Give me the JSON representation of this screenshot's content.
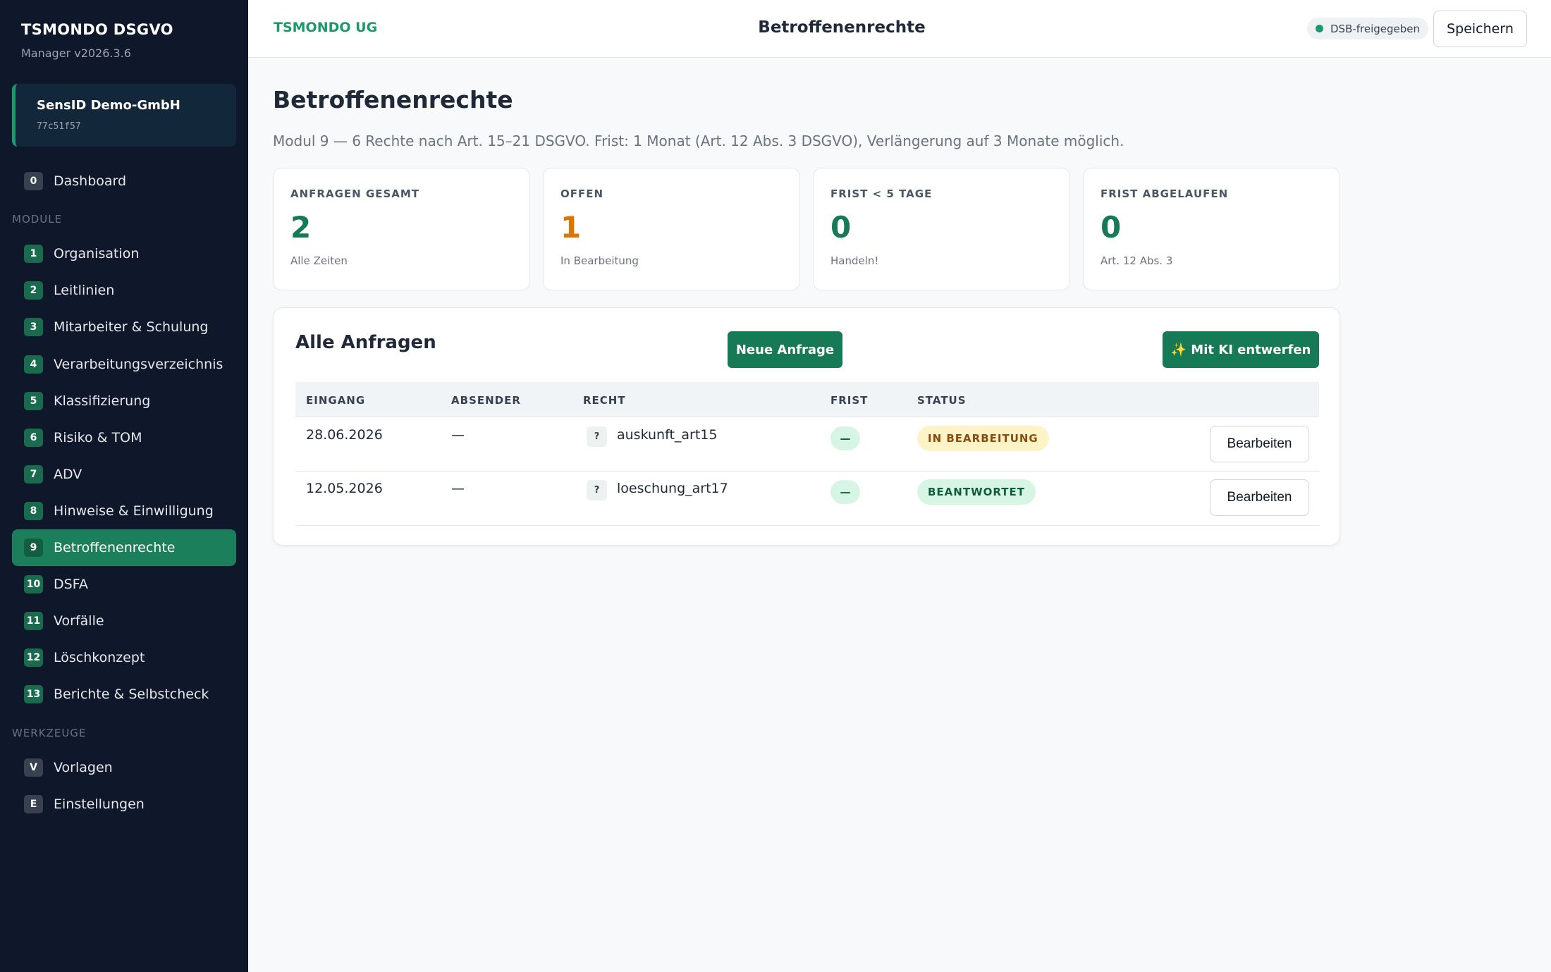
{
  "sidebar": {
    "brand_title": "TSMONDO DSGVO",
    "brand_version": "Manager v2026.3.6",
    "tenant": {
      "name": "SensID Demo-GmbH",
      "id": "77c51f57"
    },
    "dashboard": {
      "badge": "0",
      "label": "Dashboard"
    },
    "modules_label": "MODULE",
    "modules": [
      {
        "badge": "1",
        "label": "Organisation"
      },
      {
        "badge": "2",
        "label": "Leitlinien"
      },
      {
        "badge": "3",
        "label": "Mitarbeiter & Schulung"
      },
      {
        "badge": "4",
        "label": "Verarbeitungsverzeichnis"
      },
      {
        "badge": "5",
        "label": "Klassifizierung"
      },
      {
        "badge": "6",
        "label": "Risiko & TOM"
      },
      {
        "badge": "7",
        "label": "ADV"
      },
      {
        "badge": "8",
        "label": "Hinweise & Einwilligung"
      },
      {
        "badge": "9",
        "label": "Betroffenenrechte"
      },
      {
        "badge": "10",
        "label": "DSFA"
      },
      {
        "badge": "11",
        "label": "Vorfälle"
      },
      {
        "badge": "12",
        "label": "Löschkonzept"
      },
      {
        "badge": "13",
        "label": "Berichte & Selbstcheck"
      }
    ],
    "tools_label": "WERKZEUGE",
    "tools": [
      {
        "badge": "V",
        "label": "Vorlagen"
      },
      {
        "badge": "E",
        "label": "Einstellungen"
      }
    ],
    "active_module": "Betroffenenrechte"
  },
  "topbar": {
    "company": "TSMONDO UG",
    "title": "Betroffenenrechte",
    "dsb_status": "DSB-freigegeben",
    "save_label": "Speichern"
  },
  "main": {
    "title": "Betroffenenrechte",
    "subtitle": "Modul 9 — 6 Rechte nach Art. 15–21 DSGVO. Frist: 1 Monat (Art. 12 Abs. 3 DSGVO), Verlängerung auf 3 Monate möglich.",
    "kpis": [
      {
        "label": "ANFRAGEN GESAMT",
        "value": "2",
        "note": "Alle Zeiten",
        "color": "#167a57"
      },
      {
        "label": "OFFEN",
        "value": "1",
        "note": "In Bearbeitung",
        "color": "#d97706"
      },
      {
        "label": "FRIST < 5 TAGE",
        "value": "0",
        "note": "Handeln!",
        "color": "#167a57"
      },
      {
        "label": "FRIST ABGELAUFEN",
        "value": "0",
        "note": "Art. 12 Abs. 3",
        "color": "#167a57"
      }
    ],
    "panel": {
      "title": "Alle Anfragen",
      "new_button": "Neue Anfrage",
      "ai_button": "✨ Mit KI entwerfen",
      "columns": [
        "EINGANG",
        "ABSENDER",
        "RECHT",
        "FRIST",
        "STATUS"
      ],
      "rows": [
        {
          "eingang": "28.06.2026",
          "absender": "—",
          "recht_icon": "?",
          "recht": "auskunft_art15",
          "frist": "—",
          "status": "IN BEARBEITUNG",
          "status_kind": "warn",
          "action": "Bearbeiten"
        },
        {
          "eingang": "12.05.2026",
          "absender": "—",
          "recht_icon": "?",
          "recht": "loeschung_art17",
          "frist": "—",
          "status": "BEANTWORTET",
          "status_kind": "ok",
          "action": "Bearbeiten"
        }
      ]
    }
  }
}
